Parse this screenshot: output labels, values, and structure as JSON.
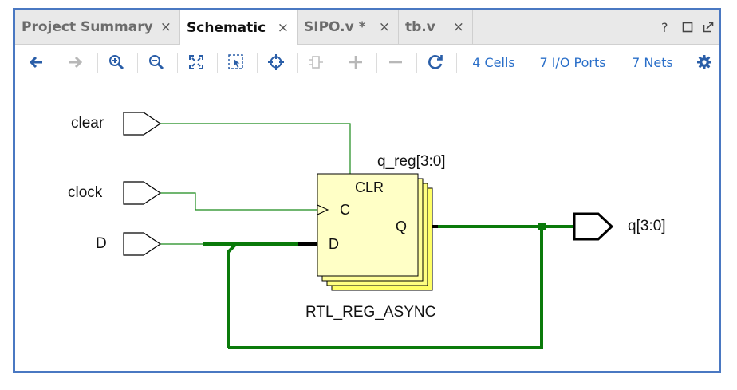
{
  "tabs": [
    {
      "label": "Project Summary",
      "close": "×"
    },
    {
      "label": "Schematic",
      "close": "×"
    },
    {
      "label": "SIPO.v *",
      "close": "×"
    },
    {
      "label": "tb.v",
      "close": "×"
    }
  ],
  "window_controls": {
    "help": "?"
  },
  "toolbar": {
    "cells": "4 Cells",
    "io_ports": "7 I/O Ports",
    "nets": "7 Nets"
  },
  "schematic": {
    "inputs": [
      "clear",
      "clock",
      "D"
    ],
    "output": "q[3:0]",
    "cell_name": "q_reg[3:0]",
    "cell_type": "RTL_REG_ASYNC",
    "pins": {
      "clr": "CLR",
      "c": "C",
      "d": "D",
      "q": "Q"
    }
  },
  "colors": {
    "accent": "#4a78c2",
    "net_green": "#1a8a1a",
    "bus_green": "#0a7a0a",
    "cell_yellow": "#ffffb0",
    "link": "#2a6fc9"
  }
}
